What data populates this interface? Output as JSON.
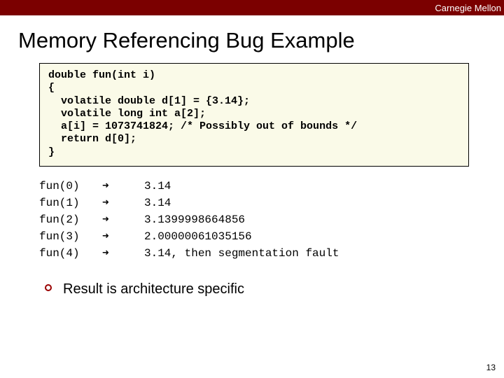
{
  "header": {
    "brand": "Carnegie Mellon"
  },
  "slide": {
    "title": "Memory Referencing Bug Example",
    "code_lines": [
      "double fun(int i)",
      "{",
      "  volatile double d[1] = {3.14};",
      "  volatile long int a[2];",
      "  a[i] = 1073741824; /* Possibly out of bounds */",
      "  return d[0];",
      "}"
    ],
    "arrow": "➜",
    "results": [
      {
        "call": "fun(0)",
        "value": "3.14"
      },
      {
        "call": "fun(1)",
        "value": "3.14"
      },
      {
        "call": "fun(2)",
        "value": "3.1399998664856"
      },
      {
        "call": "fun(3)",
        "value": "2.00000061035156"
      },
      {
        "call": "fun(4)",
        "value": "3.14, then segmentation fault"
      }
    ],
    "bullet": "Result is architecture specific",
    "pagenum": "13"
  }
}
